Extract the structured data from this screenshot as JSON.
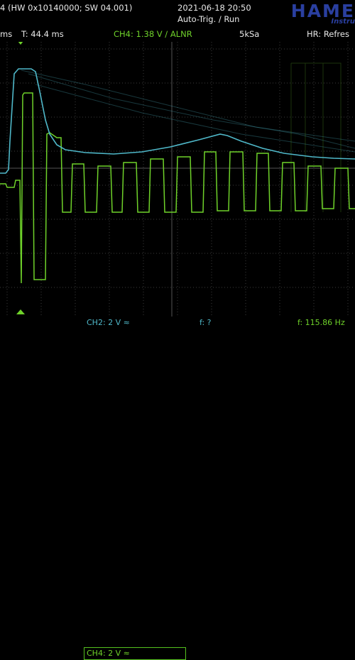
{
  "header": {
    "firmware": "4 (HW 0x10140000; SW 04.001)",
    "datetime": "2021-06-18 20:50",
    "trigger_mode": "Auto-Trig. / Run",
    "brand": "HAME",
    "brand_sub": "Instru"
  },
  "status_bar": {
    "timebase_fragment": "ms",
    "trigger_time": "T: 44.4 ms",
    "trigger_info": "CH4: 1.38 V ∕ ALNR",
    "sample_rate": "5kSa",
    "hr_mode": "HR: Refres"
  },
  "footer": {
    "ch2_label": "CH2: 2 V ≈",
    "ch4_label": "CH4: 2 V ≈",
    "freq_unknown": "f: ?",
    "freq_value": "f: 115.86 Hz"
  },
  "colors": {
    "ch2": "#4fb8c9",
    "ch4": "#6fd22a",
    "grid": "#3b3b3b",
    "brand": "#2a3fa0"
  },
  "icons": {
    "trigger_marker": "triangle-down-icon",
    "ground_marker": "triangle-up-icon"
  }
}
